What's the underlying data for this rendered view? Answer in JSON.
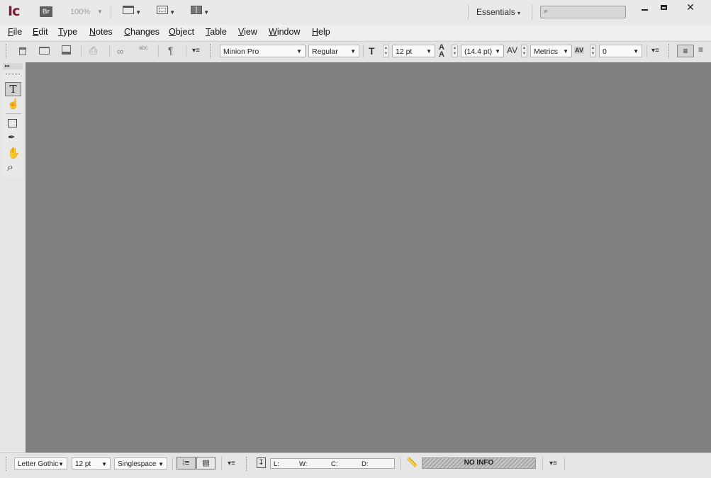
{
  "titlebar": {
    "app_logo": "Ic",
    "bridge": "Br",
    "zoom": "100%",
    "workspace": "Essentials"
  },
  "menu": {
    "file": {
      "first": "F",
      "rest": "ile"
    },
    "edit": {
      "first": "E",
      "rest": "dit"
    },
    "type": {
      "first": "T",
      "rest": "ype"
    },
    "notes": {
      "first": "N",
      "rest": "otes"
    },
    "changes": {
      "first": "C",
      "rest": "hanges"
    },
    "object": {
      "first": "O",
      "rest": "bject"
    },
    "table": {
      "first": "T",
      "rest": "able"
    },
    "view": {
      "first": "V",
      "rest": "iew"
    },
    "window": {
      "first": "W",
      "rest": "indow"
    },
    "help": {
      "first": "H",
      "rest": "elp"
    }
  },
  "toolbar": {
    "font": "Minion Pro",
    "style": "Regular",
    "size": "12 pt",
    "leading": "(14.4 pt)",
    "kerning": "Metrics",
    "tracking": "0",
    "spell_label": "abc"
  },
  "status": {
    "font": "Letter Gothic",
    "size": "12 pt",
    "spacing": "Singlespace",
    "l": "L:",
    "w": "W:",
    "c": "C:",
    "d": "D:",
    "info": "NO INFO"
  }
}
